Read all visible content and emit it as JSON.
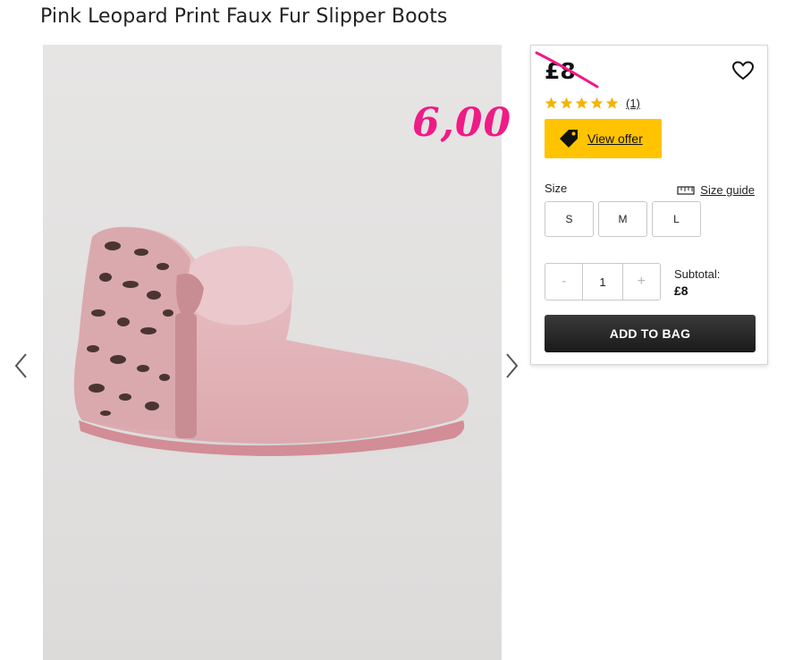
{
  "product": {
    "title": "Pink Leopard Print Faux Fur Slipper Boots",
    "price": "£8",
    "rating": 5,
    "rating_max": 5,
    "review_count": "(1)"
  },
  "offer": {
    "label": "View offer"
  },
  "sizes": {
    "label": "Size",
    "guide_label": "Size guide",
    "options": [
      "S",
      "M",
      "L"
    ]
  },
  "quantity": {
    "minus": "-",
    "value": "1",
    "plus": "+"
  },
  "subtotal": {
    "label": "Subtotal:",
    "value": "£8"
  },
  "actions": {
    "add_to_bag": "ADD TO BAG"
  },
  "annotation": {
    "text": "6,00"
  },
  "icons": {
    "previous": "chevron-left-icon",
    "next": "chevron-right-icon",
    "wishlist": "heart-icon",
    "star": "star-icon",
    "offer": "price-tag-icon",
    "size_guide": "ruler-icon"
  },
  "colors": {
    "offer_button": "#ffc300",
    "star": "#f5b400",
    "annotation": "#ef1b86",
    "add_button": "#222222"
  }
}
